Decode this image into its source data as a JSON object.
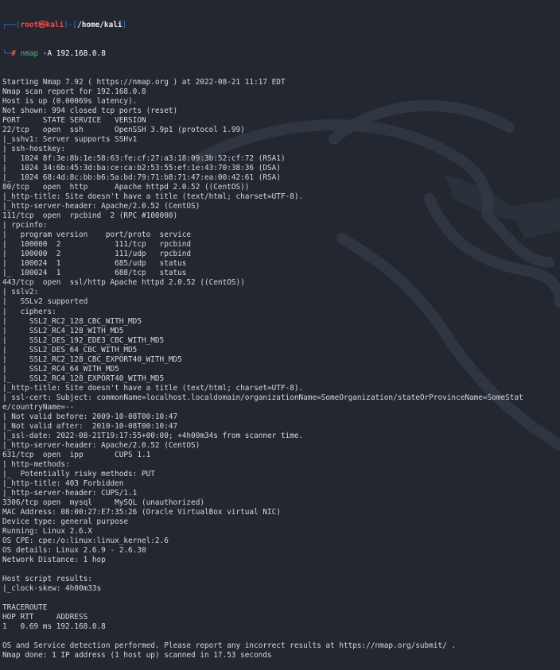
{
  "prompt": {
    "corner_top": "┌──(",
    "user": "root",
    "at": "㉿",
    "host": "kali",
    "mid": ")-[",
    "path": "/home/kali",
    "close": "]",
    "corner_bottom": "└─",
    "dollar": "# ",
    "command": "nmap",
    "flag": " -A",
    "target": " 192.168.0.8"
  },
  "output_lines": [
    "Starting Nmap 7.92 ( https://nmap.org ) at 2022-08-21 11:17 EDT",
    "Nmap scan report for 192.168.0.8",
    "Host is up (0.00069s latency).",
    "Not shown: 994 closed tcp ports (reset)",
    "PORT     STATE SERVICE   VERSION",
    "22/tcp   open  ssh       OpenSSH 3.9p1 (protocol 1.99)",
    "|_sshv1: Server supports SSHv1",
    "| ssh-hostkey:",
    "|   1024 8f:3e:8b:1e:58:63:fe:cf:27:a3:18:09:3b:52:cf:72 (RSA1)",
    "|   1024 34:6b:45:3d:ba:ce:ca:b2:53:55:ef:1e:43:70:38:36 (DSA)",
    "|_  1024 68:4d:8c:bb:b6:5a:bd:79:71:b8:71:47:ea:00:42:61 (RSA)",
    "80/tcp   open  http      Apache httpd 2.0.52 ((CentOS))",
    "|_http-title: Site doesn't have a title (text/html; charset=UTF-8).",
    "|_http-server-header: Apache/2.0.52 (CentOS)",
    "111/tcp  open  rpcbind  2 (RPC #100000)",
    "| rpcinfo:",
    "|   program version    port/proto  service",
    "|   100000  2            111/tcp   rpcbind",
    "|   100000  2            111/udp   rpcbind",
    "|   100024  1            685/udp   status",
    "|_  100024  1            688/tcp   status",
    "443/tcp  open  ssl/http Apache httpd 2.0.52 ((CentOS))",
    "| sslv2:",
    "|   SSLv2 supported",
    "|   ciphers:",
    "|     SSL2_RC2_128_CBC_WITH_MD5",
    "|     SSL2_RC4_128_WITH_MD5",
    "|     SSL2_DES_192_EDE3_CBC_WITH_MD5",
    "|     SSL2_DES_64_CBC_WITH_MD5",
    "|     SSL2_RC2_128_CBC_EXPORT40_WITH_MD5",
    "|     SSL2_RC4_64_WITH_MD5",
    "|_    SSL2_RC4_128_EXPORT40_WITH_MD5",
    "|_http-title: Site doesn't have a title (text/html; charset=UTF-8).",
    "| ssl-cert: Subject: commonName=localhost.localdomain/organizationName=SomeOrganization/stateOrProvinceName=SomeStat",
    "e/countryName=--",
    "| Not valid before: 2009-10-08T00:10:47",
    "|_Not valid after:  2010-10-08T00:10:47",
    "|_ssl-date: 2022-08-21T19:17:55+00:00; +4h00m34s from scanner time.",
    "|_http-server-header: Apache/2.0.52 (CentOS)",
    "631/tcp  open  ipp       CUPS 1.1",
    "| http-methods:",
    "|_  Potentially risky methods: PUT",
    "|_http-title: 403 Forbidden",
    "|_http-server-header: CUPS/1.1",
    "3306/tcp open  mysql     MySQL (unauthorized)",
    "MAC Address: 08:00:27:E7:35:26 (Oracle VirtualBox virtual NIC)",
    "Device type: general purpose",
    "Running: Linux 2.6.X",
    "OS CPE: cpe:/o:linux:linux_kernel:2.6",
    "OS details: Linux 2.6.9 - 2.6.30",
    "Network Distance: 1 hop",
    "",
    "Host script results:",
    "|_clock-skew: 4h00m33s",
    "",
    "TRACEROUTE",
    "HOP RTT     ADDRESS",
    "1   0.69 ms 192.168.0.8",
    "",
    "OS and Service detection performed. Please report any incorrect results at https://nmap.org/submit/ .",
    "Nmap done: 1 IP address (1 host up) scanned in 17.53 seconds"
  ]
}
